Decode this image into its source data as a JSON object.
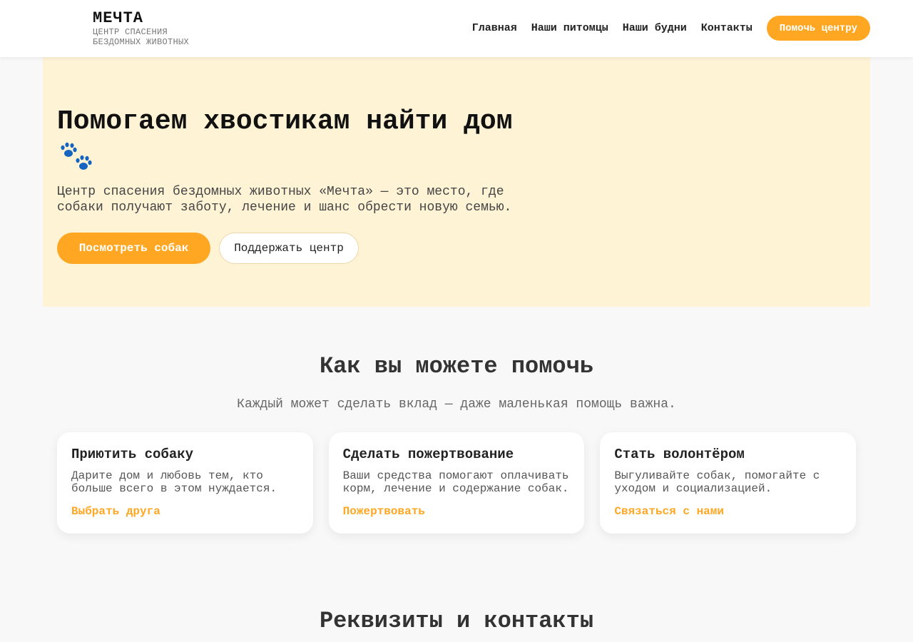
{
  "header": {
    "logo_title": "МЕЧТА",
    "logo_subtitle": "ЦЕНТР СПАСЕНИЯ БЕЗДОМНЫХ ЖИВОТНЫХ",
    "nav": [
      "Главная",
      "Наши питомцы",
      "Наши будни",
      "Контакты"
    ],
    "cta_label": "Помочь центру"
  },
  "hero": {
    "title": "Помогаем хвостикам найти дом",
    "icon": "paw-prints-icon",
    "text": "Центр спасения бездомных животных «Мечта» — это место, где собаки получают заботу, лечение и шанс обрести новую семью.",
    "primary_button": "Посмотреть собак",
    "secondary_button": "Поддержать центр"
  },
  "help": {
    "title": "Как вы можете помочь",
    "subtitle": "Каждый может сделать вклад — даже маленькая помощь важна.",
    "cards": [
      {
        "title": "Приютить собаку",
        "text": "Дарите дом и любовь тем, кто больше всего в этом нуждается.",
        "link": "Выбрать друга"
      },
      {
        "title": "Сделать пожертвование",
        "text": "Ваши средства помогают оплачивать корм, лечение и содержание собак.",
        "link": "Пожертвовать"
      },
      {
        "title": "Стать волонтёром",
        "text": "Выгуливайте собак, помогайте с уходом и социализацией.",
        "link": "Связаться с нами"
      }
    ]
  },
  "contacts": {
    "title": "Реквизиты и контакты"
  },
  "colors": {
    "accent": "#ffa722",
    "hero_background": "#fff3d6",
    "page_background": "#f8f8f8",
    "paw_icon": "#1565c0"
  }
}
